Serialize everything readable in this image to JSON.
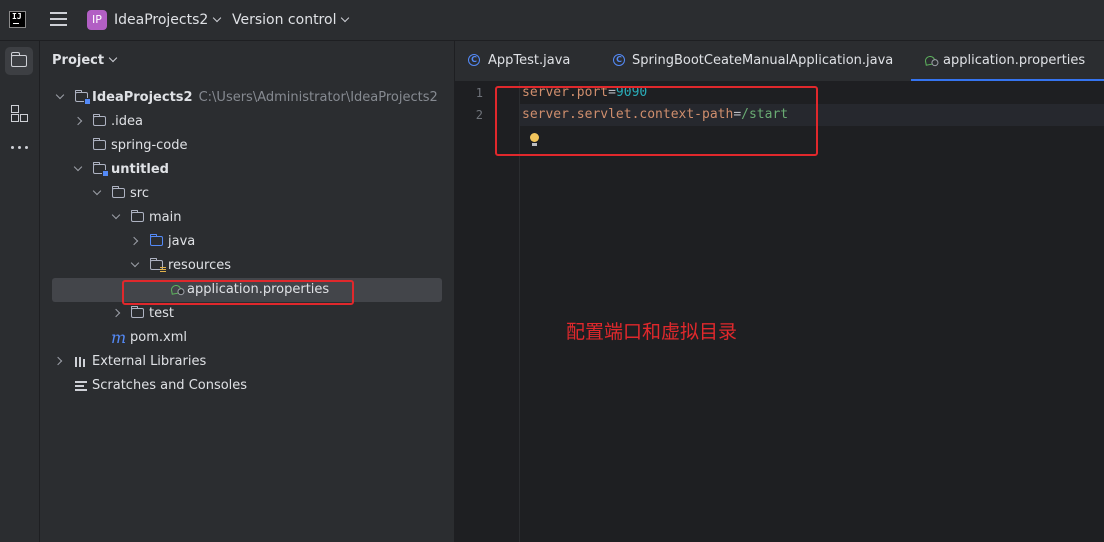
{
  "titlebar": {
    "project_badge": "IP",
    "project_name": "IdeaProjects2",
    "version_control": "Version control"
  },
  "panel": {
    "title": "Project",
    "tree": [
      {
        "label": "IdeaProjects2",
        "hint": "C:\\Users\\Administrator\\IdeaProjects2"
      },
      {
        "label": ".idea"
      },
      {
        "label": "spring-code"
      },
      {
        "label": "untitled"
      },
      {
        "label": "src"
      },
      {
        "label": "main"
      },
      {
        "label": "java"
      },
      {
        "label": "resources"
      },
      {
        "label": "application.properties"
      },
      {
        "label": "test"
      },
      {
        "label": "pom.xml"
      },
      {
        "label": "External Libraries"
      },
      {
        "label": "Scratches and Consoles"
      }
    ]
  },
  "tabs": [
    {
      "label": "AppTest.java"
    },
    {
      "label": "SpringBootCeateManualApplication.java"
    },
    {
      "label": "application.properties"
    }
  ],
  "editor": {
    "line_numbers": [
      "1",
      "2"
    ],
    "line1": {
      "key": "server.port",
      "eq": "=",
      "value": "9090"
    },
    "line2": {
      "key": "server.servlet.context-path",
      "eq": "=",
      "value": "/start"
    }
  },
  "annotation": "配置端口和虚拟目录",
  "colors": {
    "highlight": "#e0282c",
    "accent": "#3574f0",
    "property_key": "#cf8e6d",
    "property_value": "#6aab73",
    "number": "#2aacb8"
  },
  "icons": {
    "logo": "intellij-logo",
    "menu": "hamburger-icon",
    "tool_project": "folder-icon",
    "tool_structure": "structure-icon",
    "tool_more": "more-icon",
    "properties": "spring-leaf-icon",
    "maven": "maven-m-icon",
    "intention": "lightbulb-icon"
  }
}
